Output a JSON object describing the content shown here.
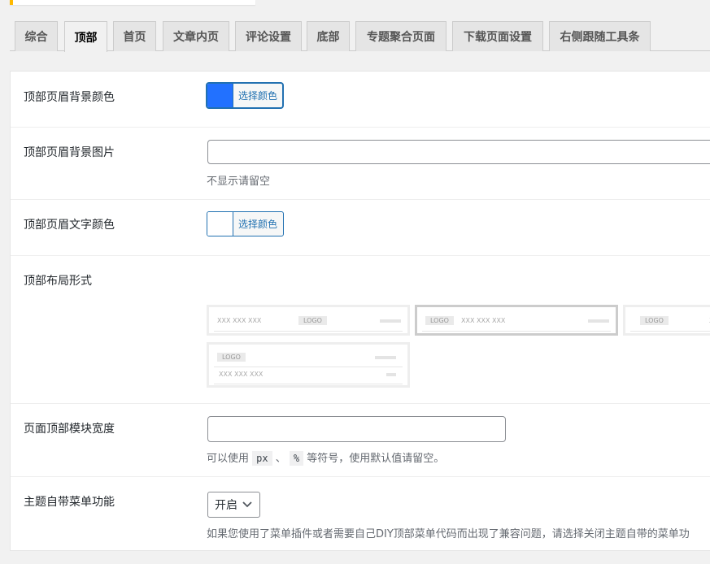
{
  "tabs": [
    {
      "label": "综合"
    },
    {
      "label": "顶部",
      "active": true
    },
    {
      "label": "首页"
    },
    {
      "label": "文章内页"
    },
    {
      "label": "评论设置"
    },
    {
      "label": "底部"
    },
    {
      "label": "专题聚合页面"
    },
    {
      "label": "下载页面设置"
    },
    {
      "label": "右侧跟随工具条"
    }
  ],
  "settings": {
    "header_bg_color": {
      "label": "顶部页眉背景颜色",
      "button": "选择颜色",
      "color": "#2271ff"
    },
    "header_bg_image": {
      "label": "顶部页眉背景图片",
      "value": "",
      "desc": "不显示请留空"
    },
    "header_text_color": {
      "label": "顶部页眉文字颜色",
      "button": "选择颜色",
      "color": "#ffffff"
    },
    "header_layout": {
      "label": "顶部布局形式",
      "options": {
        "o1": {
          "text": "XXX XXX XXX",
          "logo": "LOGO"
        },
        "o2": {
          "logo": "LOGO",
          "text": "XXX XXX XXX"
        },
        "o3": {
          "logo": "LOGO",
          "text": "X"
        },
        "o4": {
          "logo": "LOGO",
          "text": "XXX XXX XXX"
        }
      },
      "selected": 2
    },
    "header_width": {
      "label": "页面顶部模块宽度",
      "value": "",
      "desc_pre": "可以使用",
      "code1": "px",
      "sep": "、",
      "code2": "%",
      "desc_post": "等符号，使用默认值请留空。"
    },
    "theme_menu": {
      "label": "主题自带菜单功能",
      "selected": "开启",
      "desc": "如果您使用了菜单插件或者需要自己DIY顶部菜单代码而出现了兼容问题，请选择关闭主题自带的菜单功"
    }
  },
  "icons": {
    "select_arrow": "chevron-down-icon"
  }
}
